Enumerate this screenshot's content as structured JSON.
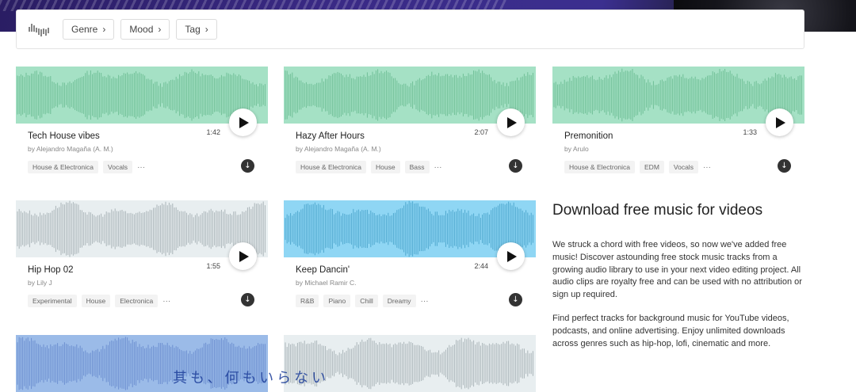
{
  "filters": [
    {
      "label": "Genre"
    },
    {
      "label": "Mood"
    },
    {
      "label": "Tag"
    }
  ],
  "tracks": [
    {
      "title": "Tech House vibes",
      "author": "by Alejandro Magaña (A. M.)",
      "duration": "1:42",
      "tags": [
        "House & Electronica",
        "Vocals"
      ],
      "more": "···",
      "wave_color": "#a5e1c5",
      "bar_color": "#6fbf96"
    },
    {
      "title": "Hazy After Hours",
      "author": "by Alejandro Magaña (A. M.)",
      "duration": "2:07",
      "tags": [
        "House & Electronica",
        "House",
        "Bass"
      ],
      "more": "···",
      "wave_color": "#a5e1c5",
      "bar_color": "#6fbf96"
    },
    {
      "title": "Premonition",
      "author": "by Arulo",
      "duration": "1:33",
      "tags": [
        "House & Electronica",
        "EDM",
        "Vocals"
      ],
      "more": "···",
      "wave_color": "#a5e1c5",
      "bar_color": "#6fbf96"
    },
    {
      "title": "Hip Hop 02",
      "author": "by Lily J",
      "duration": "1:55",
      "tags": [
        "Experimental",
        "House",
        "Electronica"
      ],
      "more": "···",
      "wave_color": "#e8eef0",
      "bar_color": "#aab4b8"
    },
    {
      "title": "Keep Dancin'",
      "author": "by Michael Ramir C.",
      "duration": "2:44",
      "tags": [
        "R&B",
        "Piano",
        "Chill",
        "Dreamy"
      ],
      "more": "···",
      "wave_color": "#8fd6f4",
      "bar_color": "#4fa8cf"
    },
    {
      "wave_color": "#9bbbe8",
      "bar_color": "#6c8fd0"
    },
    {
      "wave_color": "#e8eef0",
      "bar_color": "#aab4b8"
    }
  ],
  "info": {
    "heading": "Download free music for videos",
    "p1": "We struck a chord with free videos, so now we've added free music! Discover astounding free stock music tracks from a growing audio library to use in your next video editing project. All audio clips are royalty free and can be used with no attribution or sign up required.",
    "p2": "Find perfect tracks for background music for YouTube videos, podcasts, and online advertising. Enjoy unlimited downloads across genres such as hip-hop, lofi, cinematic and more."
  },
  "overlay_text": "其も、何もいらない"
}
